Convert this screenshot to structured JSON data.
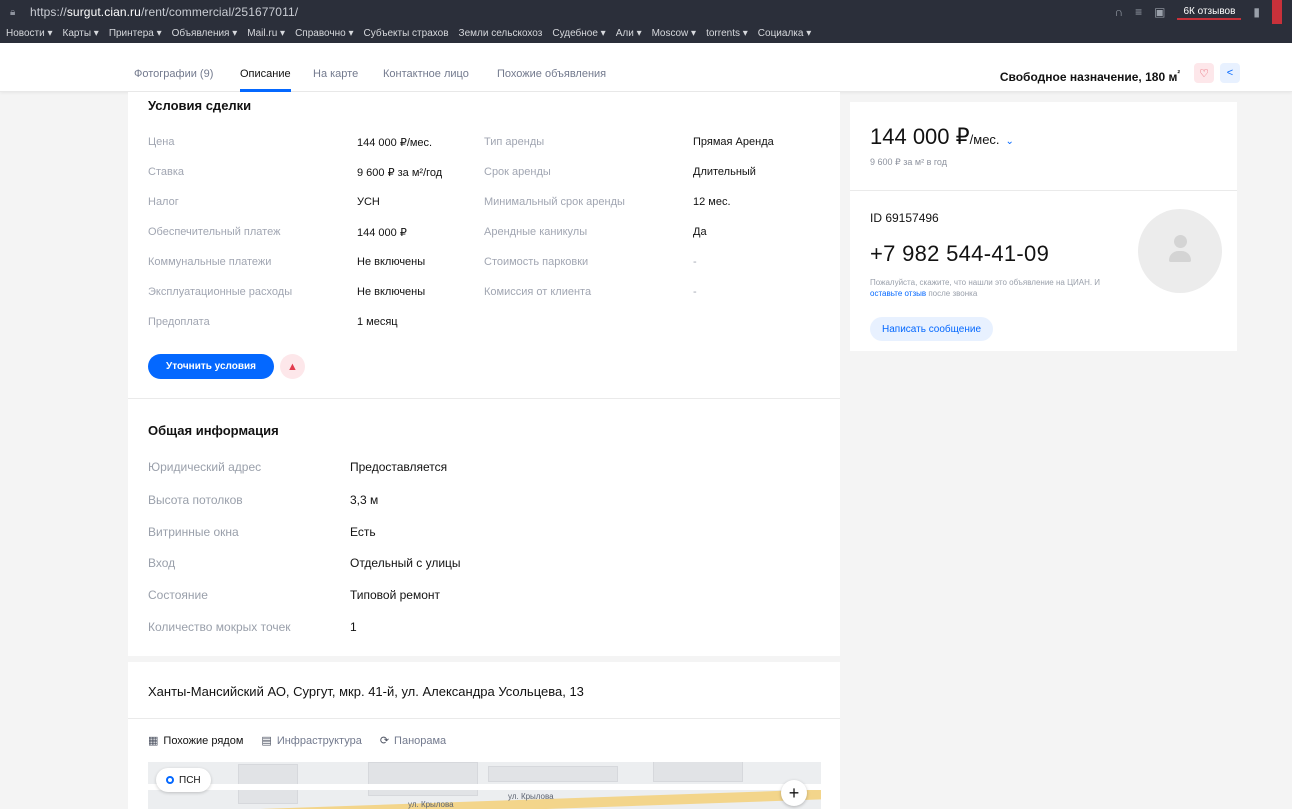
{
  "browser": {
    "url_prefix": "https://",
    "url_host": "surgut.cian.ru",
    "url_path": "/rent/commercial/251677011/",
    "reviews_badge": "6К отзывов"
  },
  "bookmarks": [
    "Новости ▾",
    "Карты ▾",
    "Принтера ▾",
    "Объявления ▾",
    "Mail.ru ▾",
    "Справочно ▾",
    "Субъекты страхов",
    "Земли сельскохоз",
    "Судебное ▾",
    "Али ▾",
    "Moscow ▾",
    "torrents ▾",
    "Социалка ▾"
  ],
  "tabs": {
    "photos": "Фотографии (9)",
    "description": "Описание",
    "map": "На карте",
    "contact": "Контактное лицо",
    "similar": "Похожие объявления",
    "summary": "Свободное назначение, 180 м",
    "summary_sup": "²"
  },
  "deal": {
    "title": "Условия сделки",
    "left": [
      {
        "label": "Цена",
        "value": "144 000 ₽/мес."
      },
      {
        "label": "Ставка",
        "value": "9 600 ₽ за м²/год"
      },
      {
        "label": "Налог",
        "value": "УСН"
      },
      {
        "label": "Обеспечительный платеж",
        "value": "144 000 ₽"
      },
      {
        "label": "Коммунальные платежи",
        "value": "Не включены"
      },
      {
        "label": "Эксплуатационные расходы",
        "value": "Не включены"
      },
      {
        "label": "Предоплата",
        "value": "1 месяц"
      }
    ],
    "right": [
      {
        "label": "Тип аренды",
        "value": "Прямая Аренда"
      },
      {
        "label": "Срок аренды",
        "value": "Длительный"
      },
      {
        "label": "Минимальный срок аренды",
        "value": "12 мес."
      },
      {
        "label": "Арендные каникулы",
        "value": "Да"
      },
      {
        "label": "Стоимость парковки",
        "value": "-"
      },
      {
        "label": "Комиссия от клиента",
        "value": "-"
      }
    ],
    "clarify_button": "Уточнить условия",
    "warn_icon": "▲"
  },
  "general": {
    "title": "Общая информация",
    "rows": [
      {
        "label": "Юридический адрес",
        "value": "Предоставляется"
      },
      {
        "label": "Высота потолков",
        "value": "3,3 м"
      },
      {
        "label": "Витринные окна",
        "value": "Есть"
      },
      {
        "label": "Вход",
        "value": "Отдельный с улицы"
      },
      {
        "label": "Состояние",
        "value": "Типовой ремонт"
      },
      {
        "label": "Количество мокрых точек",
        "value": "1"
      }
    ]
  },
  "location": {
    "address": "Ханты-Мансийский АО, Сургут, мкр. 41-й, ул. Александра Усольцева, 13",
    "map_tabs": [
      "Похожие рядом",
      "Инфраструктура",
      "Панорама"
    ],
    "psn_label": "ПСН",
    "street1": "ул. Крылова",
    "street2": "ул. Крылова",
    "zoom": "+"
  },
  "offer": {
    "price": "144 000 ₽",
    "price_unit": "/мес.",
    "price_sub": "9 600 ₽ за м² в год",
    "id": "ID 69157496",
    "phone": "+7 982 544-41-09",
    "note_1": "Пожалуйста, скажите, что нашли это объявление на ЦИАН. И ",
    "note_link": "оставьте отзыв",
    "note_2": " после звонка",
    "message_button": "Написать сообщение"
  },
  "colors": {
    "accent": "#0468ff",
    "warn": "#e23b4d"
  }
}
